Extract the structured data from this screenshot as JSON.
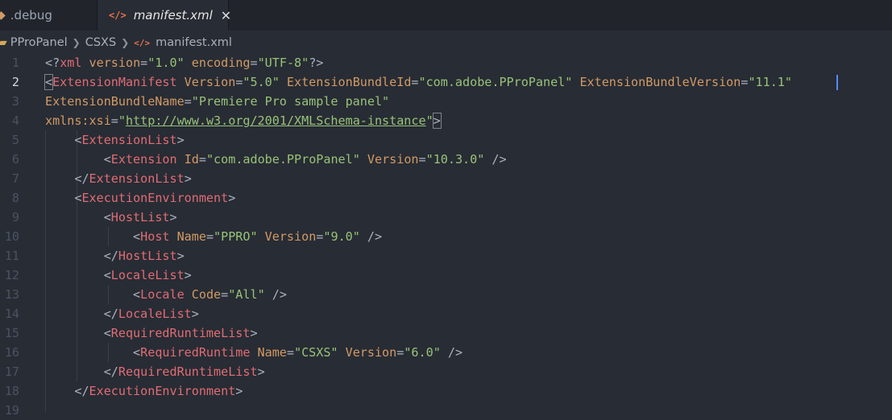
{
  "tabs": [
    {
      "label": ".debug"
    },
    {
      "label": "manifest.xml",
      "close": "✕"
    }
  ],
  "breadcrumb": [
    "PProPanel",
    "CSXS",
    "manifest.xml"
  ],
  "editor": {
    "active_line": 2,
    "lines": [
      {
        "n": "1",
        "indent": "",
        "parts": [
          [
            "p",
            "<?"
          ],
          [
            "t",
            "xml"
          ],
          [
            "p",
            " "
          ],
          [
            "a",
            "version"
          ],
          [
            "p",
            "="
          ],
          [
            "s",
            "\"1.0\""
          ],
          [
            "p",
            " "
          ],
          [
            "a",
            "encoding"
          ],
          [
            "p",
            "="
          ],
          [
            "s",
            "\"UTF-8\""
          ],
          [
            "p",
            "?>"
          ]
        ]
      },
      {
        "n": "2",
        "indent": "",
        "parts": [
          [
            "b",
            "<"
          ],
          [
            "t",
            "ExtensionManifest"
          ],
          [
            "p",
            " "
          ],
          [
            "a",
            "Version"
          ],
          [
            "p",
            "="
          ],
          [
            "s",
            "\"5.0\""
          ],
          [
            "p",
            " "
          ],
          [
            "a",
            "ExtensionBundleId"
          ],
          [
            "p",
            "="
          ],
          [
            "s",
            "\"com.adobe.PProPanel\""
          ],
          [
            "p",
            " "
          ],
          [
            "a",
            "ExtensionBundleVersion"
          ],
          [
            "p",
            "="
          ],
          [
            "s",
            "\"11.1\""
          ]
        ]
      },
      {
        "n": "3",
        "indent": "",
        "parts": [
          [
            "a",
            "ExtensionBundleName"
          ],
          [
            "p",
            "="
          ],
          [
            "s",
            "\"Premiere Pro sample panel\""
          ]
        ]
      },
      {
        "n": "4",
        "indent": "",
        "parts": [
          [
            "a",
            "xmlns:xsi"
          ],
          [
            "p",
            "="
          ],
          [
            "s",
            "\""
          ],
          [
            "l",
            "http://www.w3.org/2001/XMLSchema-instance"
          ],
          [
            "s",
            "\""
          ],
          [
            "b",
            ">"
          ]
        ]
      },
      {
        "n": "5",
        "indent": "    ",
        "parts": [
          [
            "p",
            "<"
          ],
          [
            "t",
            "ExtensionList"
          ],
          [
            "p",
            ">"
          ]
        ]
      },
      {
        "n": "6",
        "indent": "        ",
        "parts": [
          [
            "p",
            "<"
          ],
          [
            "t",
            "Extension"
          ],
          [
            "p",
            " "
          ],
          [
            "a",
            "Id"
          ],
          [
            "p",
            "="
          ],
          [
            "s",
            "\"com.adobe.PProPanel\""
          ],
          [
            "p",
            " "
          ],
          [
            "a",
            "Version"
          ],
          [
            "p",
            "="
          ],
          [
            "s",
            "\"10.3.0\""
          ],
          [
            "p",
            " />"
          ]
        ]
      },
      {
        "n": "7",
        "indent": "    ",
        "parts": [
          [
            "p",
            "</"
          ],
          [
            "t",
            "ExtensionList"
          ],
          [
            "p",
            ">"
          ]
        ]
      },
      {
        "n": "8",
        "indent": "    ",
        "parts": [
          [
            "p",
            "<"
          ],
          [
            "t",
            "ExecutionEnvironment"
          ],
          [
            "p",
            ">"
          ]
        ]
      },
      {
        "n": "9",
        "indent": "        ",
        "parts": [
          [
            "p",
            "<"
          ],
          [
            "t",
            "HostList"
          ],
          [
            "p",
            ">"
          ]
        ]
      },
      {
        "n": "10",
        "indent": "            ",
        "parts": [
          [
            "p",
            "<"
          ],
          [
            "t",
            "Host"
          ],
          [
            "p",
            " "
          ],
          [
            "a",
            "Name"
          ],
          [
            "p",
            "="
          ],
          [
            "s",
            "\"PPRO\""
          ],
          [
            "p",
            " "
          ],
          [
            "a",
            "Version"
          ],
          [
            "p",
            "="
          ],
          [
            "s",
            "\"9.0\""
          ],
          [
            "p",
            " />"
          ]
        ]
      },
      {
        "n": "11",
        "indent": "        ",
        "parts": [
          [
            "p",
            "</"
          ],
          [
            "t",
            "HostList"
          ],
          [
            "p",
            ">"
          ]
        ]
      },
      {
        "n": "12",
        "indent": "        ",
        "parts": [
          [
            "p",
            "<"
          ],
          [
            "t",
            "LocaleList"
          ],
          [
            "p",
            ">"
          ]
        ]
      },
      {
        "n": "13",
        "indent": "            ",
        "parts": [
          [
            "p",
            "<"
          ],
          [
            "t",
            "Locale"
          ],
          [
            "p",
            " "
          ],
          [
            "a",
            "Code"
          ],
          [
            "p",
            "="
          ],
          [
            "s",
            "\"All\""
          ],
          [
            "p",
            " />"
          ]
        ]
      },
      {
        "n": "14",
        "indent": "        ",
        "parts": [
          [
            "p",
            "</"
          ],
          [
            "t",
            "LocaleList"
          ],
          [
            "p",
            ">"
          ]
        ]
      },
      {
        "n": "15",
        "indent": "        ",
        "parts": [
          [
            "p",
            "<"
          ],
          [
            "t",
            "RequiredRuntimeList"
          ],
          [
            "p",
            ">"
          ]
        ]
      },
      {
        "n": "16",
        "indent": "            ",
        "parts": [
          [
            "p",
            "<"
          ],
          [
            "t",
            "RequiredRuntime"
          ],
          [
            "p",
            " "
          ],
          [
            "a",
            "Name"
          ],
          [
            "p",
            "="
          ],
          [
            "s",
            "\"CSXS\""
          ],
          [
            "p",
            " "
          ],
          [
            "a",
            "Version"
          ],
          [
            "p",
            "="
          ],
          [
            "s",
            "\"6.0\""
          ],
          [
            "p",
            " />"
          ]
        ]
      },
      {
        "n": "17",
        "indent": "        ",
        "parts": [
          [
            "p",
            "</"
          ],
          [
            "t",
            "RequiredRuntimeList"
          ],
          [
            "p",
            ">"
          ]
        ]
      },
      {
        "n": "18",
        "indent": "    ",
        "parts": [
          [
            "p",
            "</"
          ],
          [
            "t",
            "ExecutionEnvironment"
          ],
          [
            "p",
            ">"
          ]
        ]
      },
      {
        "n": "19",
        "indent": "",
        "parts": []
      }
    ]
  }
}
